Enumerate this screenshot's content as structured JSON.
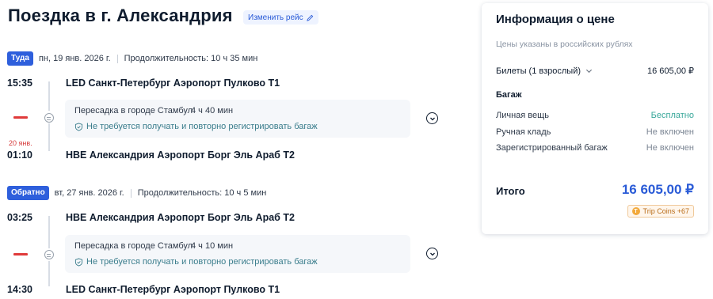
{
  "header": {
    "title": "Поездка в г. Александрия",
    "change_button": "Изменить рейс",
    "change_icon": "pencil-icon"
  },
  "outbound": {
    "badge": "Туда",
    "date": "пн, 19 янв. 2026 г.",
    "duration": "Продолжительность: 10 ч 35 мин",
    "dep_time": "15:35",
    "dep_airport": "LED Санкт-Петербург Аэропорт Пулково T1",
    "transfer_city": "Пересадка в городе Стамбул",
    "transfer_duration": "4 ч 40 мин",
    "transfer_note": "Не требуется получать и повторно регистрировать багаж",
    "arr_nextday": "20 янв.",
    "arr_time": "01:10",
    "arr_airport": "HBE Александрия Аэропорт Борг Эль Араб T2"
  },
  "return": {
    "badge": "Обратно",
    "date": "вт, 27 янв. 2026 г.",
    "duration": "Продолжительность: 10 ч 5 мин",
    "dep_time": "03:25",
    "dep_airport": "HBE Александрия Аэропорт Борг Эль Араб T2",
    "transfer_city": "Пересадка в городе Стамбул",
    "transfer_duration": "4 ч 10 мин",
    "transfer_note": "Не требуется получать и повторно регистрировать багаж",
    "arr_time": "14:30",
    "arr_airport": "LED Санкт-Петербург Аэропорт Пулково T1"
  },
  "price": {
    "title": "Информация о цене",
    "subtitle": "Цены указаны в российских рублях",
    "tickets_label": "Билеты (1 взрослый)",
    "tickets_value": "16 605,00 ₽",
    "baggage_header": "Багаж",
    "personal_item_label": "Личная вещь",
    "personal_item_value": "Бесплатно",
    "carry_on_label": "Ручная кладь",
    "carry_on_value": "Не включен",
    "checked_label": "Зарегистрированный багаж",
    "checked_value": "Не включен",
    "total_label": "Итого",
    "total_value": "16 605,00 ₽",
    "coins": "Trip Coins +67",
    "coin_symbol": "T"
  },
  "colors": {
    "accent": "#2e5fdc",
    "price": "#2a5bd7",
    "free": "#3aa89b",
    "nextday": "#d63b3b"
  }
}
